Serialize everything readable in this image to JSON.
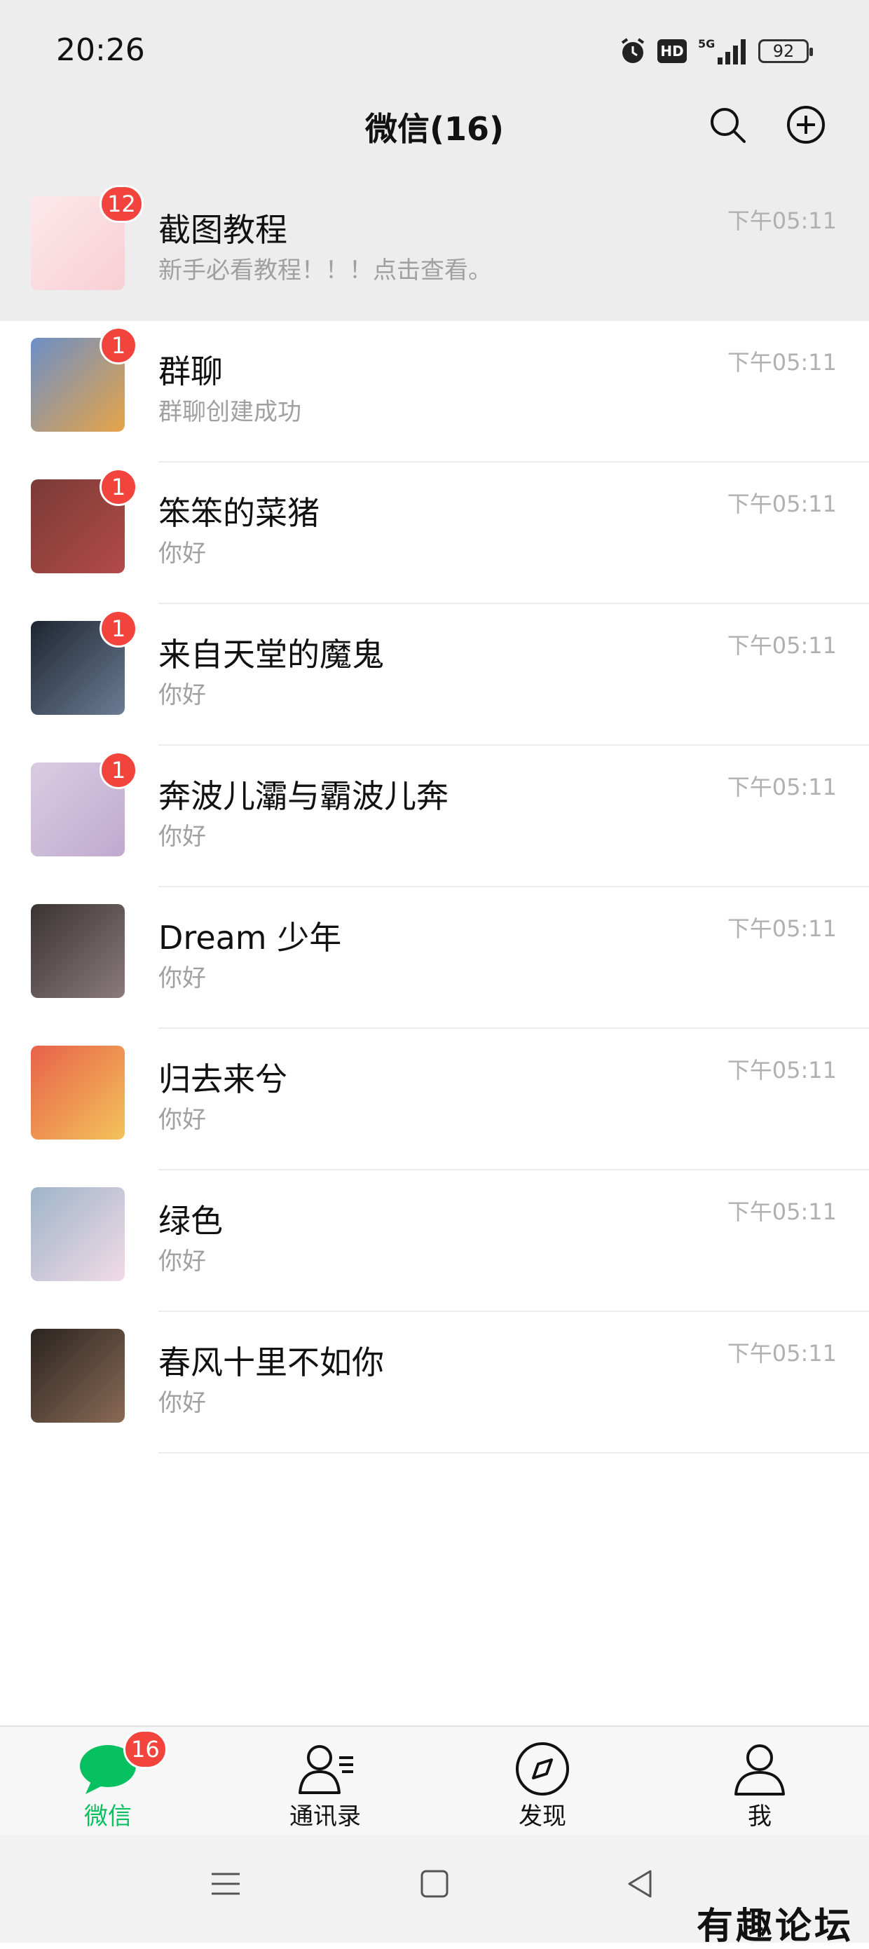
{
  "status_bar": {
    "time": "20:26",
    "hd_label": "HD",
    "network": "5G",
    "battery": "92"
  },
  "header": {
    "title": "微信(16)",
    "search_icon": "search-icon",
    "add_icon": "plus-circle-icon"
  },
  "chats": [
    {
      "name": "截图教程",
      "preview": "新手必看教程！！！点击查看。",
      "time": "下午05:11",
      "badge": "12",
      "pinned": true,
      "avatar_colors": [
        "#fde8ea",
        "#f7cfd5"
      ]
    },
    {
      "name": "群聊",
      "preview": "群聊创建成功",
      "time": "下午05:11",
      "badge": "1",
      "avatar_colors": [
        "#6b8fc7",
        "#e7a447"
      ]
    },
    {
      "name": "笨笨的菜猪",
      "preview": "你好",
      "time": "下午05:11",
      "badge": "1",
      "avatar_colors": [
        "#7a3b35",
        "#b24a4a"
      ]
    },
    {
      "name": "来自天堂的魔鬼",
      "preview": "你好",
      "time": "下午05:11",
      "badge": "1",
      "avatar_colors": [
        "#1e2530",
        "#6b7c95"
      ]
    },
    {
      "name": "奔波儿灞与霸波儿奔",
      "preview": "你好",
      "time": "下午05:11",
      "badge": "1",
      "avatar_colors": [
        "#d9cce2",
        "#bfaad0"
      ]
    },
    {
      "name": "Dream 少年",
      "preview": "你好",
      "time": "下午05:11",
      "badge": "",
      "avatar_colors": [
        "#3b3333",
        "#8a7b7b"
      ]
    },
    {
      "name": "归去来兮",
      "preview": "你好",
      "time": "下午05:11",
      "badge": "",
      "avatar_colors": [
        "#e8614a",
        "#f3c35a"
      ]
    },
    {
      "name": "绿色",
      "preview": "你好",
      "time": "下午05:11",
      "badge": "",
      "avatar_colors": [
        "#9fb4c9",
        "#f1dbe6"
      ]
    },
    {
      "name": "春风十里不如你",
      "preview": "你好",
      "time": "下午05:11",
      "badge": "",
      "avatar_colors": [
        "#2a2420",
        "#8a6a55"
      ]
    }
  ],
  "tabs": [
    {
      "label": "微信",
      "icon": "chat-bubble-icon",
      "active": true,
      "badge": "16"
    },
    {
      "label": "通讯录",
      "icon": "contacts-icon",
      "active": false
    },
    {
      "label": "发现",
      "icon": "compass-icon",
      "active": false
    },
    {
      "label": "我",
      "icon": "person-icon",
      "active": false
    }
  ],
  "colors": {
    "accent": "#07c160",
    "badge": "#f2443c",
    "header_bg": "#ededed"
  },
  "watermark": "有趣论坛"
}
